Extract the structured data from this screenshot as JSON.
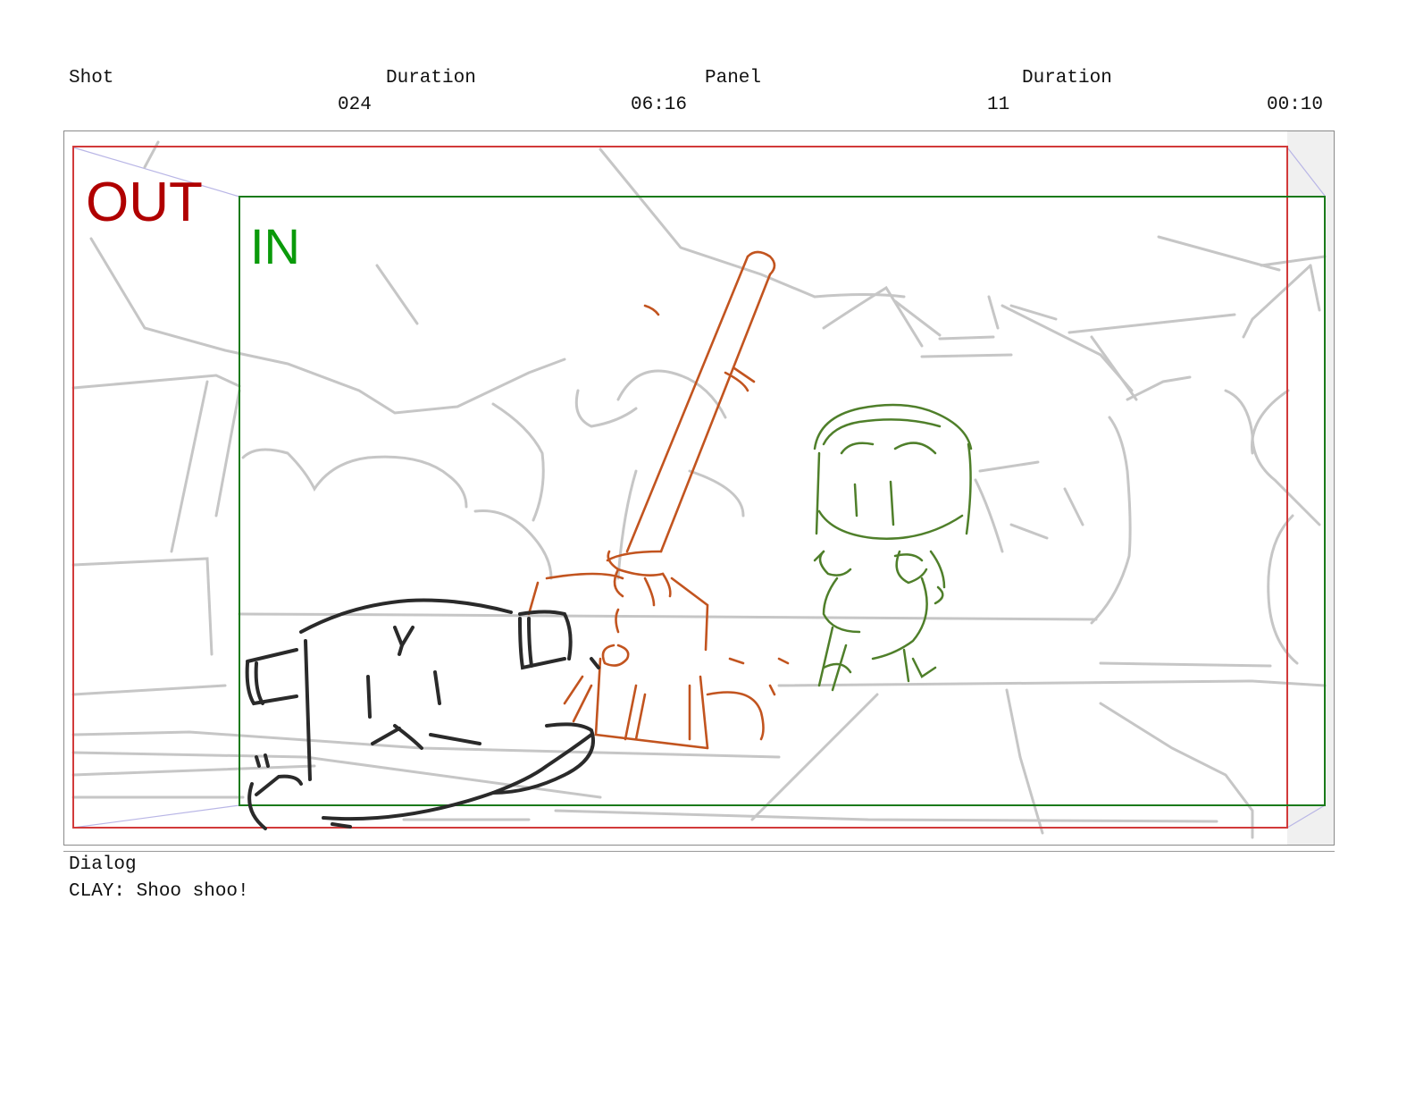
{
  "header": {
    "labels": {
      "shot": "Shot",
      "duration": "Duration",
      "panel": "Panel",
      "panel_duration": "Duration"
    },
    "values": {
      "shot": "024",
      "shot_duration": "06:16",
      "panel": "11",
      "panel_duration": "00:10"
    }
  },
  "frame": {
    "out_label": "OUT",
    "in_label": "IN",
    "out_color": "#b00000",
    "in_color": "#0a9a0a"
  },
  "dialog": {
    "label": "Dialog",
    "line": "CLAY: Shoo shoo!"
  }
}
